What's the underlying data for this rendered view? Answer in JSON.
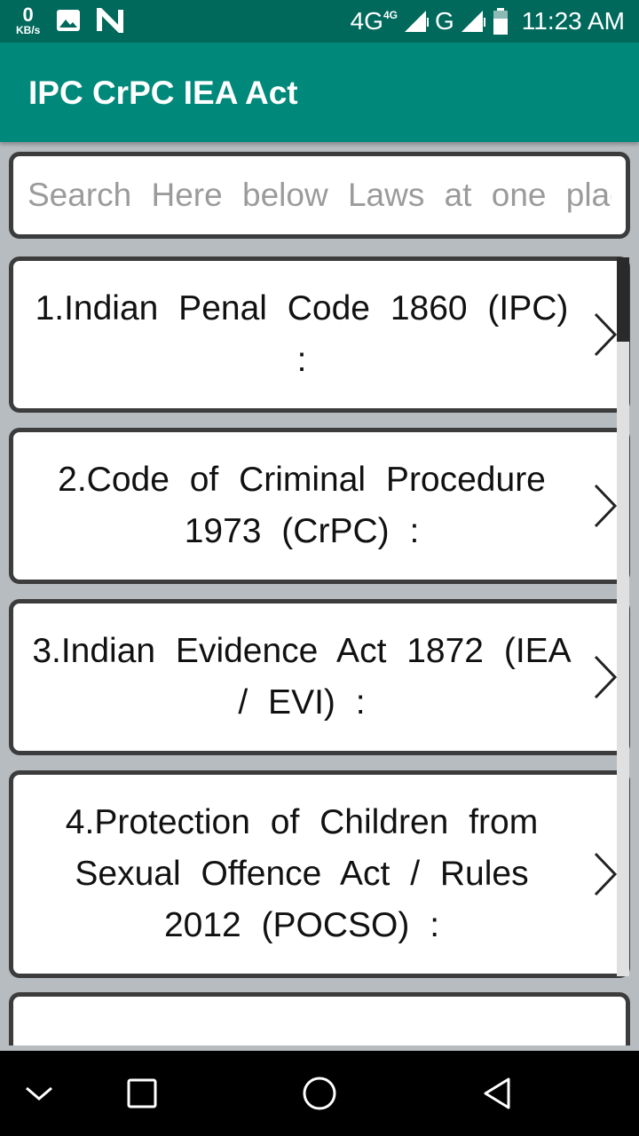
{
  "status_bar": {
    "speed_value": "0",
    "speed_unit": "KB/s",
    "network_primary": "4G",
    "network_sup": "4G",
    "network_secondary": "G",
    "time": "11:23 AM",
    "icons": [
      "image-icon",
      "n-notification-icon",
      "signal-icon",
      "battery-icon"
    ]
  },
  "app_bar": {
    "title": "IPC CrPC IEA Act",
    "background": "#00897b",
    "status_background": "#00695c"
  },
  "search": {
    "placeholder": "Search Here below Laws at one place"
  },
  "items": [
    {
      "label": "1.Indian Penal Code 1860 (IPC) :"
    },
    {
      "label": "2.Code of Criminal Procedure 1973 (CrPC) :"
    },
    {
      "label": "3.Indian Evidence Act 1872 (IEA / EVI) :"
    },
    {
      "label": "4.Protection of Children from Sexual Offence Act / Rules 2012 (POCSO) :"
    }
  ],
  "nav_bar": {
    "buttons": [
      "chevron-down-icon",
      "recents-square-icon",
      "home-circle-icon",
      "back-triangle-icon"
    ]
  }
}
